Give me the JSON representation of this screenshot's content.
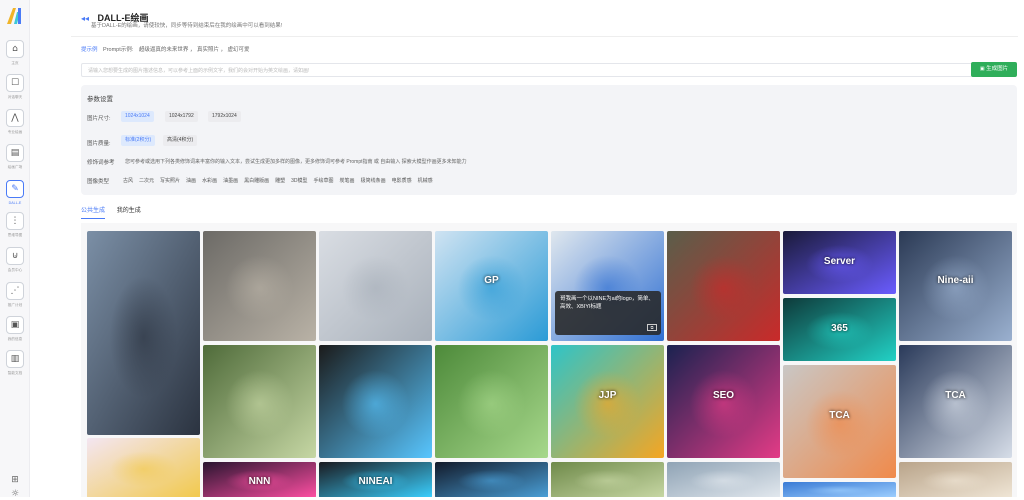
{
  "sidebar": {
    "logo_icon": "ai-logo-icon",
    "items": [
      {
        "label": "主页",
        "icon": "home-icon",
        "glyph": "⌂"
      },
      {
        "label": "对话聊天",
        "icon": "chat-icon",
        "glyph": "☐"
      },
      {
        "label": "专业绘画",
        "icon": "draw-icon",
        "glyph": "⋀"
      },
      {
        "label": "绘画广场",
        "icon": "gallery-icon",
        "glyph": "▤"
      },
      {
        "label": "DALL-E",
        "icon": "dalle-icon",
        "glyph": "✎"
      },
      {
        "label": "思维导图",
        "icon": "mindmap-icon",
        "glyph": "⋮"
      },
      {
        "label": "会员中心",
        "icon": "cart-icon",
        "glyph": "⊍"
      },
      {
        "label": "推广计划",
        "icon": "share-icon",
        "glyph": "⋰"
      },
      {
        "label": "我的信息",
        "icon": "user-info-icon",
        "glyph": "▣"
      },
      {
        "label": "智能文档",
        "icon": "doc-icon",
        "glyph": "▥"
      }
    ],
    "bottom": [
      {
        "icon": "gift-icon",
        "glyph": "⊞"
      },
      {
        "icon": "theme-icon",
        "glyph": "☼"
      }
    ]
  },
  "header": {
    "title": "DALL-E绘画",
    "subtitle": "基于DALL-E的绘画，请使较快，同步等待到结束后在我的绘画中可以看到结果!"
  },
  "prompt": {
    "lead": "提示例",
    "label": "Prompt示例:",
    "examples": [
      "超级逼真的未来世界",
      "真实照片",
      "虚幻可爱"
    ],
    "placeholder": "请输入您想要生成的图片描述信息，可以参考上面的示例文字，我们的会对开始为英文绘画，请如画!",
    "button": "生成图片"
  },
  "settings": {
    "title": "参数设置",
    "size_label": "图片尺寸:",
    "sizes": [
      "1024x1024",
      "1024x1792",
      "1792x1024"
    ],
    "quality_label": "图片质量:",
    "qualities": [
      "标准(2积分)",
      "高清(4积分)"
    ],
    "modifier_label": "修饰词参考",
    "modifier_text": "您可参考或选用下列各类修饰词来丰富你的输入文本，尝试生成更加多样的图像，更多修饰词可参考 Prompt指南 或 自由输入 探索大模型作画更多未知能力",
    "type_label": "图像类型",
    "types": [
      "古风",
      "二次元",
      "写实照片",
      "油画",
      "水彩画",
      "油墨画",
      "黑白雕版画",
      "雕塑",
      "3D模型",
      "手绘草图",
      "炭笔画",
      "极简线条画",
      "电影质感",
      "机械感"
    ]
  },
  "tabs": [
    "公共生成",
    "我的生成"
  ],
  "gallery": {
    "tooltip": "哥我画一个以NINE为ai的logo，简单、高效、XBIYI标题",
    "images": [
      {
        "name": "superhero-image",
        "colors": [
          "#7b8fa6",
          "#2b3340"
        ],
        "caption": ""
      },
      {
        "name": "workshop-image",
        "colors": [
          "#6c6a66",
          "#b9b2a6"
        ],
        "caption": ""
      },
      {
        "name": "mario-twins-image",
        "colors": [
          "#d9dde3",
          "#a8b0ba"
        ],
        "caption": ""
      },
      {
        "name": "gpt-logo-image",
        "colors": [
          "#cfe3f2",
          "#2b9bd6"
        ],
        "caption": "GP"
      },
      {
        "name": "x-logo-image",
        "colors": [
          "#dfe7ee",
          "#2f6fd2"
        ],
        "caption": ""
      },
      {
        "name": "rose-image",
        "colors": [
          "#5a5e4a",
          "#c92a2a"
        ],
        "caption": ""
      },
      {
        "name": "server-image",
        "colors": [
          "#1a1a3a",
          "#6a5cff"
        ],
        "caption": "Server"
      },
      {
        "name": "nine-ai-image",
        "colors": [
          "#2b3a55",
          "#9ab0cf"
        ],
        "caption": "Nine-aii"
      },
      {
        "name": "panda-branch-image",
        "colors": [
          "#4f6b3a",
          "#c6d7a4"
        ],
        "caption": ""
      },
      {
        "name": "robot-panda-image",
        "colors": [
          "#1b1b1b",
          "#58c6ff"
        ],
        "caption": ""
      },
      {
        "name": "panda-forest-image",
        "colors": [
          "#4d8a3a",
          "#a7d88b"
        ],
        "caption": ""
      },
      {
        "name": "jjp-logo-image",
        "colors": [
          "#2ec4c8",
          "#f5a623"
        ],
        "caption": "JJP"
      },
      {
        "name": "seo-logo-image",
        "colors": [
          "#1a2250",
          "#e33b86"
        ],
        "caption": "SEO"
      },
      {
        "name": "365-logo-image",
        "colors": [
          "#0e3a3a",
          "#22d1c5"
        ],
        "caption": "365"
      },
      {
        "name": "tca-orange-image",
        "colors": [
          "#c9c7c5",
          "#f08a4b"
        ],
        "caption": "TCA"
      },
      {
        "name": "tca-dark-image",
        "colors": [
          "#2a3a5a",
          "#d6dde8"
        ],
        "caption": "TCA"
      },
      {
        "name": "anime-girl-image",
        "colors": [
          "#f3e6f2",
          "#f2c94c"
        ],
        "caption": ""
      },
      {
        "name": "nnn-neon-image",
        "colors": [
          "#2a1530",
          "#ff4fa3"
        ],
        "caption": "NNN"
      },
      {
        "name": "ninea-dark-image",
        "colors": [
          "#1a1a1f",
          "#3ad0ff"
        ],
        "caption": "NINEAI"
      },
      {
        "name": "city-night-image",
        "colors": [
          "#121a2a",
          "#4aa0d8"
        ],
        "caption": ""
      },
      {
        "name": "bamboo-image",
        "colors": [
          "#6f8a4a",
          "#c7d7a4"
        ],
        "caption": ""
      },
      {
        "name": "glass-building-image",
        "colors": [
          "#8fa3b5",
          "#e2e8ee"
        ],
        "caption": ""
      },
      {
        "name": "blue-screen-image",
        "colors": [
          "#3a7bd5",
          "#9fd0ff"
        ],
        "caption": ""
      },
      {
        "name": "interior-image",
        "colors": [
          "#b9a48a",
          "#f0e6d6"
        ],
        "caption": ""
      }
    ]
  }
}
